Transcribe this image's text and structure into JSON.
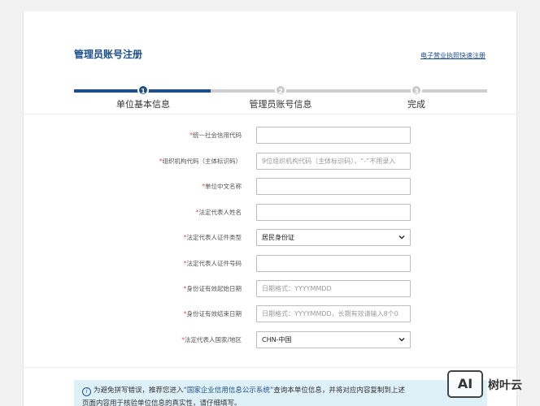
{
  "header": {
    "title": "管理员账号注册",
    "quick_link": "电子营业执照快速注册"
  },
  "stepper": {
    "progress": 0.33,
    "steps": [
      {
        "number": "1",
        "label": "单位基本信息",
        "state": "active"
      },
      {
        "number": "2",
        "label": "管理员账号信息",
        "state": "pending"
      },
      {
        "number": "3",
        "label": "完成",
        "state": "pending"
      }
    ]
  },
  "form": {
    "fields": [
      {
        "label": "统一社会信用代码",
        "type": "text",
        "placeholder": "",
        "value": ""
      },
      {
        "label": "组织机构代码（主体标识码）",
        "type": "text",
        "placeholder": "9位组织机构代码（主体标识码），“-”不用录入",
        "value": ""
      },
      {
        "label": "单位中文名称",
        "type": "text",
        "placeholder": "",
        "value": ""
      },
      {
        "label": "法定代表人姓名",
        "type": "text",
        "placeholder": "",
        "value": ""
      },
      {
        "label": "法定代表人证件类型",
        "type": "select",
        "value": "居民身份证"
      },
      {
        "label": "法定代表人证件号码",
        "type": "text",
        "placeholder": "",
        "value": ""
      },
      {
        "label": "身份证有效起始日期",
        "type": "text",
        "placeholder": "日期格式：YYYYMMDD",
        "value": ""
      },
      {
        "label": "身份证有效结束日期",
        "type": "text",
        "placeholder": "日期格式：YYYYMMDD，长期有效请输入8个0",
        "value": ""
      },
      {
        "label": "法定代表人国家/地区",
        "type": "select",
        "value": "CHN-中国"
      }
    ],
    "required_mark": "*"
  },
  "notice": {
    "text_before": "为避免拼写错误，推荐您进入",
    "link": "“国家企业信用信息公示系统”",
    "text_after": "查询本单位信息，并将对应内容复制到上述",
    "line2": "页面内容用于核验单位信息的真实性，请仔细填写。"
  },
  "watermark": {
    "logo": "AI",
    "text": "树叶云"
  },
  "colors": {
    "accent": "#1d4f8c",
    "inactive": "#c8c8c8",
    "notice_bg": "#dff1f8"
  }
}
